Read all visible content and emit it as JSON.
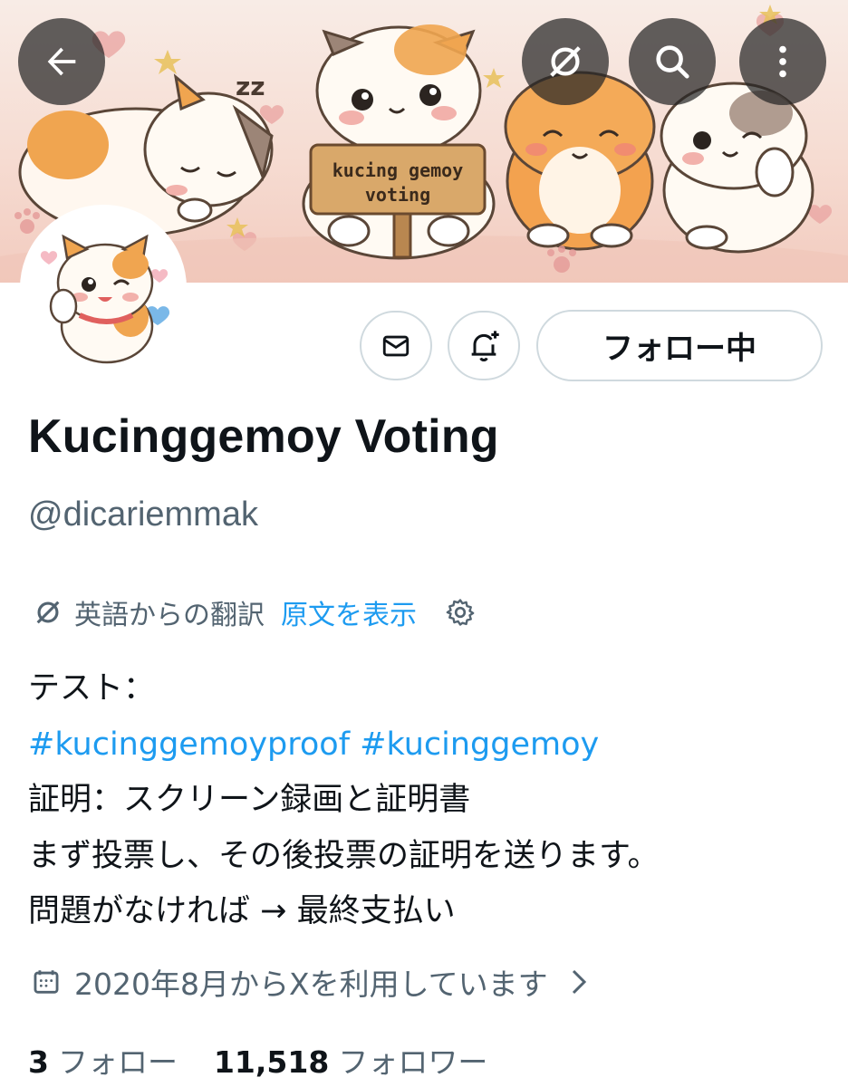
{
  "header": {
    "back_icon": "arrow-left-icon",
    "translate_icon": "translate-icon",
    "search_icon": "search-icon",
    "more_icon": "more-vertical-icon"
  },
  "banner": {
    "sign_line1": "kucing gemoy",
    "sign_line2": "voting",
    "sleep_text": "zz"
  },
  "actions": {
    "message_icon": "mail-icon",
    "notify_icon": "bell-plus-icon",
    "follow_label": "フォロー中"
  },
  "profile": {
    "display_name": "Kucinggemoy Voting",
    "handle": "@dicariemmak"
  },
  "translation": {
    "label": "英語からの翻訳",
    "show_original": "原文を表示",
    "settings_icon": "gear-icon"
  },
  "bio": {
    "line1": "テスト：",
    "hashtag1": "#kucinggemoyproof",
    "hashtag2": "#kucinggemoy",
    "line3": "証明：スクリーン録画と証明書",
    "line4": "まず投票し、その後投票の証明を送ります。",
    "line5": "問題がなければ → 最終支払い"
  },
  "joined": {
    "icon": "calendar-icon",
    "text": "2020年8月からXを利用しています"
  },
  "stats": {
    "following_count": "3",
    "following_label": "フォロー",
    "followers_count": "11,518",
    "followers_label": "フォロワー"
  },
  "colors": {
    "accent": "#1d9bf0",
    "text_primary": "#0f1419",
    "text_secondary": "#536471",
    "border": "#cfd9de"
  }
}
